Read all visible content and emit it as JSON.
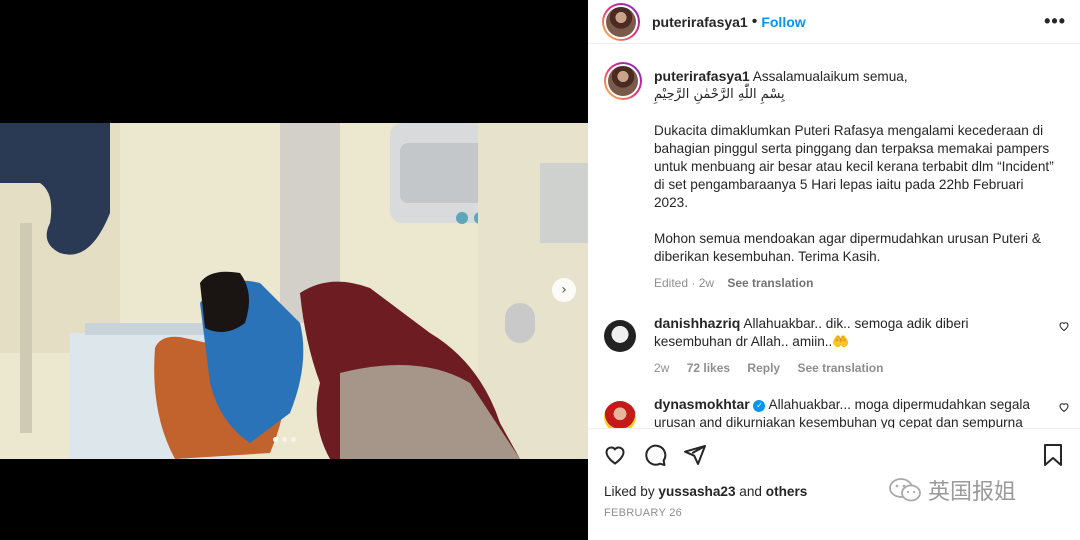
{
  "post": {
    "username": "puterirafasya1",
    "follow_label": "Follow",
    "more_label": "•••",
    "carousel_next": "›",
    "carousel": {
      "count": 3,
      "active": 0
    }
  },
  "caption": {
    "username": "puterirafasya1",
    "greeting": "Assalamualaikum semua,",
    "arabic": "بِسْمِ اللّٰهِ الرَّحْمٰنِ الرَّحِيْمِ",
    "paragraph1": "Dukacita dimaklumkan Puteri Rafasya mengalami kecederaan di bahagian pinggul serta pinggang dan terpaksa memakai pampers untuk menbuang air besar atau kecil kerana terbabit dlm “Incident” di set pengambaraanya 5 Hari lepas iaitu pada 22hb Februari 2023.",
    "paragraph2": "Mohon semua mendoakan agar dipermudahkan urusan Puteri & diberikan kesembuhan. Terima Kasih.",
    "edited": "Edited · 2w",
    "see_translation": "See translation"
  },
  "comments": [
    {
      "username": "danishhazriq",
      "text": "Allahuakbar.. dik.. semoga adik diberi kesembuhan dr Allah.. amiin..",
      "emoji": "🤲",
      "time": "2w",
      "likes": "72 likes",
      "reply": "Reply",
      "see_translation": "See translation",
      "verified": false
    },
    {
      "username": "dynasmokhtar",
      "text": "Allahuakbar... moga dipermudahkan segala urusan and dikurniakan kesembuhan yg cepat dan sempurna",
      "verified": true
    }
  ],
  "footer": {
    "liked_prefix": "Liked by",
    "liked_user": "yussasha23",
    "liked_and": "and",
    "liked_others": "others",
    "date": "FEBRUARY 26"
  },
  "watermark": {
    "text": "英国报姐"
  },
  "colors": {
    "accent": "#0095f6",
    "text": "#262626",
    "muted": "#8e8e8e"
  },
  "icons": [
    "heart-icon",
    "comment-icon",
    "share-icon",
    "bookmark-icon",
    "ellipsis-icon",
    "chevron-right-icon"
  ]
}
